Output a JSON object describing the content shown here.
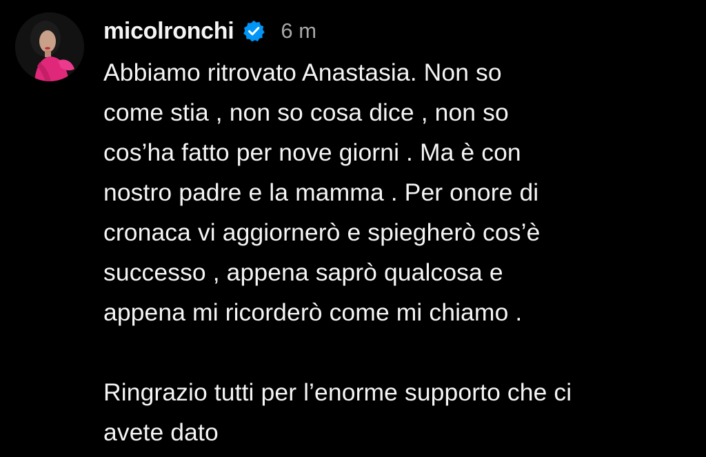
{
  "post": {
    "username": "micolronchi",
    "verified": true,
    "time": "6 m",
    "caption_lines": [
      "Abbiamo ritrovato Anastasia. Non so",
      "come stia , non so cosa dice , non so",
      "cos’ha fatto per nove giorni . Ma è con",
      "nostro padre e la mamma . Per onore di",
      "cronaca vi aggiornerò e spiegherò cos’è",
      "successo , appena saprò qualcosa e",
      "appena mi ricorderò come mi chiamo .",
      "",
      "Ringrazio tutti per l’enorme supporto che ci",
      "avete dato"
    ]
  },
  "colors": {
    "background": "#000000",
    "text": "#f5f5f5",
    "muted": "#a8a8a8",
    "verified_badge": "#0095f6",
    "avatar_outfit": "#e0287a"
  },
  "icons": {
    "avatar": "avatar",
    "verified": "verified-badge-icon"
  }
}
